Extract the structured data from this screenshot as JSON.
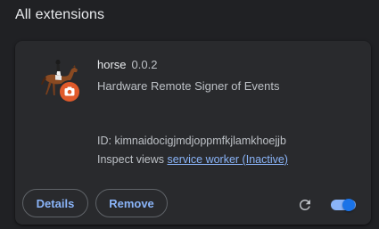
{
  "section": {
    "title": "All extensions"
  },
  "extension": {
    "icon": "horse-rider-icon",
    "badge_icon": "camera-badge-icon",
    "name": "horse",
    "version": "0.0.2",
    "description": "Hardware Remote Signer of Events",
    "id_text": "ID: kimnaidocigjmdjoppmfkjlamkhoejjb",
    "inspect_label": "Inspect views",
    "inspect_link": "service worker (Inactive)",
    "details_label": "Details",
    "remove_label": "Remove",
    "reload_icon": "reload-icon",
    "enabled": true
  },
  "colors": {
    "background": "#202124",
    "card": "#292a2d",
    "accent": "#8ab4f8",
    "badge": "#e05a2b"
  }
}
